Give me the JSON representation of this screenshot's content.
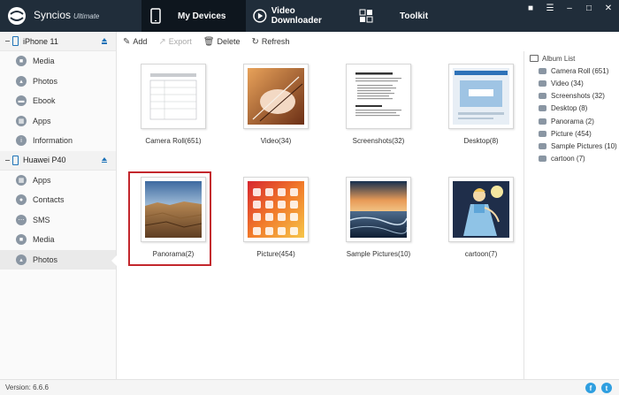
{
  "app": {
    "name": "Syncios",
    "edition": "Ultimate"
  },
  "nav": {
    "tabs": [
      {
        "label": "My Devices",
        "icon": "phone-icon"
      },
      {
        "label": "Video Downloader",
        "icon": "play-icon"
      },
      {
        "label": "Toolkit",
        "icon": "toolkit-icon"
      }
    ]
  },
  "window": {
    "buttons": [
      "chat-icon",
      "menu-icon",
      "minimize-icon",
      "maximize-icon",
      "close-icon"
    ]
  },
  "sidebar": {
    "devices": [
      {
        "name": "iPhone 11",
        "items": [
          "Media",
          "Photos",
          "Ebook",
          "Apps",
          "Information"
        ]
      },
      {
        "name": "Huawei P40",
        "items": [
          "Apps",
          "Contacts",
          "SMS",
          "Media",
          "Photos"
        ]
      }
    ]
  },
  "toolbar": {
    "add": "Add",
    "export": "Export",
    "delete": "Delete",
    "refresh": "Refresh"
  },
  "albums": [
    {
      "label": "Camera Roll(651)"
    },
    {
      "label": "Video(34)"
    },
    {
      "label": "Screenshots(32)"
    },
    {
      "label": "Desktop(8)"
    },
    {
      "label": "Panorama(2)"
    },
    {
      "label": "Picture(454)"
    },
    {
      "label": "Sample Pictures(10)"
    },
    {
      "label": "cartoon(7)"
    }
  ],
  "album_list": {
    "title": "Album List",
    "items": [
      "Camera Roll (651)",
      "Video (34)",
      "Screenshots (32)",
      "Desktop (8)",
      "Panorama (2)",
      "Picture (454)",
      "Sample Pictures (10)",
      "cartoon (7)"
    ]
  },
  "status": {
    "version": "Version: 6.6.6"
  },
  "social": {
    "facebook": "f",
    "twitter": "t"
  },
  "colors": {
    "titlebar": "#202d3a",
    "active_tab": "#0e161e",
    "selection": "#c3272d",
    "accent": "#1e73b8"
  }
}
